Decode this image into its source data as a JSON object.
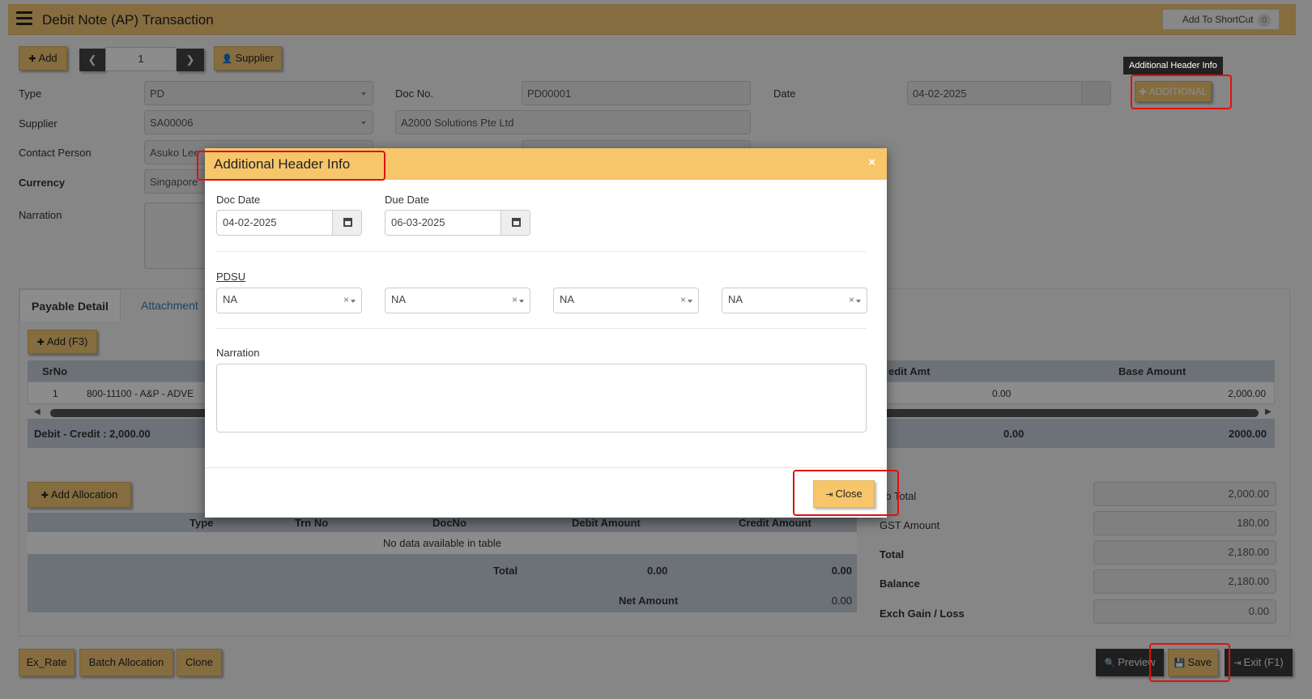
{
  "window": {
    "title": "Debit Note (AP) Transaction",
    "shortcut_label": "Add To ShortCut",
    "shortcut_count": "0"
  },
  "toolbar": {
    "add_label": "Add",
    "record_number": "1",
    "supplier_label": "Supplier"
  },
  "header": {
    "type_label": "Type",
    "type_value": "PD",
    "doc_no_label": "Doc No.",
    "doc_no_value": "PD00001",
    "date_label": "Date",
    "date_value": "04-02-2025",
    "additional_label": "ADDITIONAL",
    "supplier_label": "Supplier",
    "supplier_code": "SA00006",
    "supplier_name": "A2000 Solutions Pte Ltd",
    "contact_label": "Contact Person",
    "contact_value": "Asuko Lee",
    "currency_label": "Currency",
    "currency_value": "Singapore",
    "narration_label": "Narration"
  },
  "tabs": [
    {
      "label": "Payable Detail"
    },
    {
      "label": "Attachment"
    }
  ],
  "detail": {
    "add_label": "Add (F3)",
    "columns": {
      "srno": "SrNo",
      "credit_amt": "edit Amt",
      "base_amount": "Base Amount"
    },
    "rows": [
      {
        "srno": "1",
        "account": "800-11100 - A&P - ADVE",
        "credit": "0.00",
        "base": "2,000.00"
      }
    ],
    "summary_label": "Debit - Credit : 2,000.00",
    "summary_credit": "0.00",
    "summary_base": "2000.00"
  },
  "allocation": {
    "add_label": "Add Allocation",
    "columns": [
      "Type",
      "Trn No",
      "DocNo",
      "Debit Amount",
      "Credit Amount"
    ],
    "empty_text": "No data available in table",
    "total_label": "Total",
    "total_debit": "0.00",
    "total_credit": "0.00",
    "net_label": "Net Amount",
    "net_value": "0.00"
  },
  "totals": [
    {
      "label": "ub Total",
      "value": "2,000.00"
    },
    {
      "label": "GST Amount",
      "value": "180.00"
    },
    {
      "label": "Total",
      "value": "2,180.00"
    },
    {
      "label": "Balance",
      "value": "2,180.00"
    },
    {
      "label": "Exch Gain / Loss",
      "value": "0.00"
    }
  ],
  "footer": {
    "ex_rate": "Ex_Rate",
    "batch": "Batch Allocation",
    "clone": "Clone",
    "preview": "Preview",
    "save": "Save",
    "exit": "Exit (F1)"
  },
  "tooltip": "Additional Header Info",
  "modal": {
    "title": "Additional Header Info",
    "doc_date_label": "Doc Date",
    "doc_date_value": "04-02-2025",
    "due_date_label": "Due Date",
    "due_date_value": "06-03-2025",
    "pdsu_label": "PDSU",
    "pdsu_values": [
      "NA",
      "NA",
      "NA",
      "NA"
    ],
    "narration_label": "Narration",
    "close_label": "Close"
  },
  "colors": {
    "accent": "#f2c776",
    "modal_header": "#f7c66b",
    "grid_header": "#c6cfda",
    "highlight": "#e01010"
  }
}
